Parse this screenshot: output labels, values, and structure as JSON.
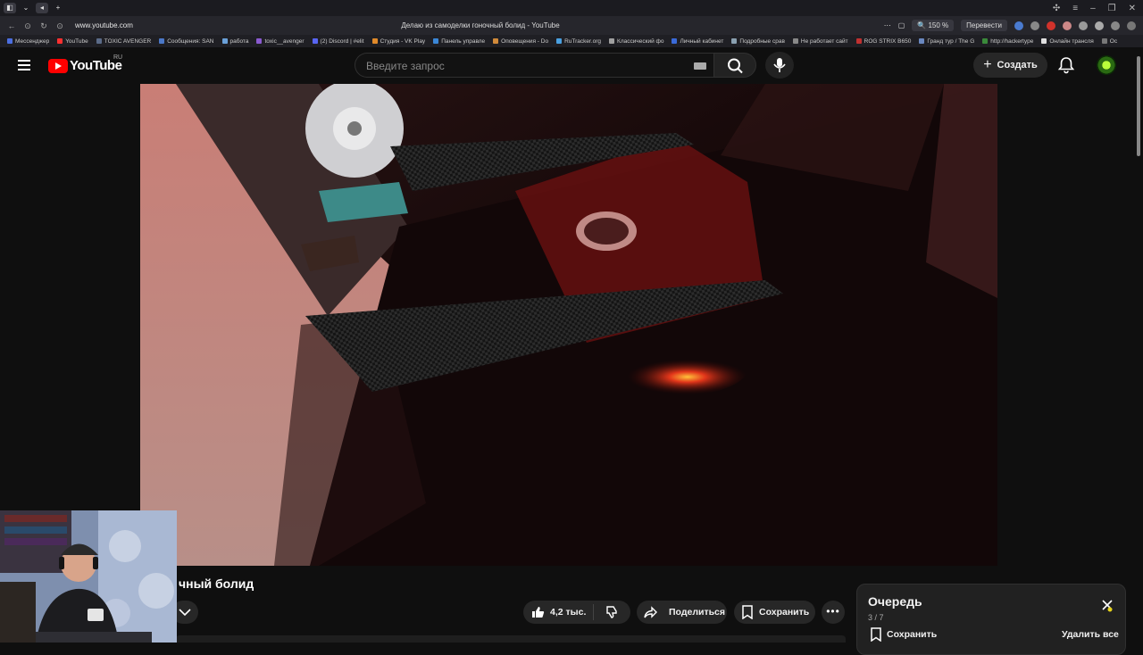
{
  "browser": {
    "url": "www.youtube.com",
    "tab_title": "Делаю из самоделки гоночный болид - YouTube",
    "zoom": "150 %",
    "translate_label": "Перевести",
    "bookmarks": [
      "Мессенджер",
      "YouTube",
      "TOXIC AVENGER",
      "Сообщения: SAN",
      "работа",
      "toxic__avenger",
      "(2) Discord | #elit",
      "Студия - VK Play",
      "Панель управле",
      "Оповещения - Do",
      "RuTracker.org",
      "Классический фо",
      "Личный кабинет",
      "Подробные срав",
      "Не работает сайт",
      "ROG STRIX B650",
      "Гранд тур / The G",
      "http://hackertype",
      "Онлайн трансля",
      "Ос"
    ]
  },
  "header": {
    "logo_text": "YouTube",
    "region": "RU",
    "search_placeholder": "Введите запрос",
    "create_label": "Создать"
  },
  "video": {
    "title_visible": "чный болид",
    "likes": "4,2 тыс.",
    "share_label": "Поделиться",
    "save_label": "Сохранить",
    "more_label": "•••"
  },
  "queue": {
    "title": "Очередь",
    "position": "3 / 7",
    "save_label": "Сохранить",
    "clear_label": "Удалить все"
  },
  "colors": {
    "brand_red": "#ff0000",
    "background": "#0f0f0f",
    "button_bg": "#272727"
  }
}
